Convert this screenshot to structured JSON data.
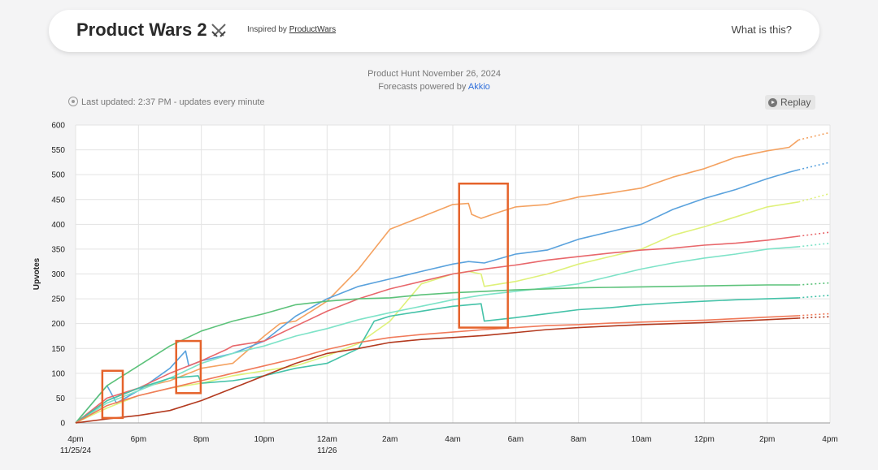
{
  "header": {
    "title": "Product Wars 2",
    "inspired_prefix": "Inspired by",
    "inspired_link": "ProductWars",
    "what_link": "What is this?"
  },
  "subtitle": {
    "line1": "Product Hunt November 26, 2024",
    "line2_prefix": "Forecasts powered by",
    "line2_link": "Akkio"
  },
  "status": {
    "last_updated": "Last updated: 2:37 PM - updates every minute",
    "replay_label": "Replay"
  },
  "chart_data": {
    "type": "line",
    "ylabel": "Upvotes",
    "xlabel": "",
    "ylim": [
      0,
      600
    ],
    "yticks": [
      0,
      50,
      100,
      150,
      200,
      250,
      300,
      350,
      400,
      450,
      500,
      550,
      600
    ],
    "xlim_hours": [
      16,
      40
    ],
    "xticks": [
      {
        "h": 16,
        "label": "4pm",
        "sub": "11/25/24"
      },
      {
        "h": 18,
        "label": "6pm"
      },
      {
        "h": 20,
        "label": "8pm"
      },
      {
        "h": 22,
        "label": "10pm"
      },
      {
        "h": 24,
        "label": "12am",
        "sub": "11/26"
      },
      {
        "h": 26,
        "label": "2am"
      },
      {
        "h": 28,
        "label": "4am"
      },
      {
        "h": 30,
        "label": "6am"
      },
      {
        "h": 32,
        "label": "8am"
      },
      {
        "h": 34,
        "label": "10am"
      },
      {
        "h": 36,
        "label": "12pm"
      },
      {
        "h": 38,
        "label": "2pm"
      },
      {
        "h": 40,
        "label": "4pm"
      }
    ],
    "grid": true,
    "forecast_style": "dotted",
    "series": [
      {
        "color": "#f4a261",
        "points": [
          [
            16,
            0
          ],
          [
            17,
            45
          ],
          [
            18,
            70
          ],
          [
            19,
            85
          ],
          [
            20,
            110
          ],
          [
            21,
            120
          ],
          [
            22,
            175
          ],
          [
            22.5,
            200
          ],
          [
            23,
            205
          ],
          [
            24,
            245
          ],
          [
            25,
            310
          ],
          [
            26,
            390
          ],
          [
            27,
            415
          ],
          [
            28,
            440
          ],
          [
            28.5,
            442
          ],
          [
            28.6,
            420
          ],
          [
            28.9,
            412
          ],
          [
            29.5,
            425
          ],
          [
            30,
            435
          ],
          [
            31,
            440
          ],
          [
            32,
            455
          ],
          [
            33,
            463
          ],
          [
            34,
            473
          ],
          [
            35,
            495
          ],
          [
            36,
            512
          ],
          [
            37,
            535
          ],
          [
            38,
            548
          ],
          [
            38.7,
            555
          ],
          [
            39,
            570
          ]
        ],
        "forecast": [
          [
            39,
            570
          ],
          [
            40,
            585
          ]
        ]
      },
      {
        "color": "#5aa2dd",
        "points": [
          [
            16,
            0
          ],
          [
            17,
            75
          ],
          [
            17.3,
            40
          ],
          [
            18,
            65
          ],
          [
            19,
            110
          ],
          [
            19.5,
            145
          ],
          [
            19.6,
            115
          ],
          [
            20,
            125
          ],
          [
            21,
            140
          ],
          [
            22,
            165
          ],
          [
            23,
            215
          ],
          [
            24,
            250
          ],
          [
            25,
            275
          ],
          [
            26,
            290
          ],
          [
            27,
            305
          ],
          [
            28,
            320
          ],
          [
            28.5,
            325
          ],
          [
            29,
            322
          ],
          [
            30,
            340
          ],
          [
            31,
            348
          ],
          [
            32,
            370
          ],
          [
            33,
            385
          ],
          [
            34,
            400
          ],
          [
            35,
            430
          ],
          [
            36,
            452
          ],
          [
            37,
            470
          ],
          [
            38,
            492
          ],
          [
            38.7,
            505
          ],
          [
            39,
            510
          ]
        ],
        "forecast": [
          [
            39,
            510
          ],
          [
            40,
            525
          ]
        ]
      },
      {
        "color": "#dff17a",
        "points": [
          [
            16,
            0
          ],
          [
            17,
            30
          ],
          [
            18,
            55
          ],
          [
            19,
            70
          ],
          [
            20,
            80
          ],
          [
            21,
            95
          ],
          [
            22,
            105
          ],
          [
            23,
            115
          ],
          [
            24,
            135
          ],
          [
            25,
            160
          ],
          [
            26,
            205
          ],
          [
            27,
            280
          ],
          [
            28,
            300
          ],
          [
            28.5,
            305
          ],
          [
            28.9,
            300
          ],
          [
            29,
            275
          ],
          [
            30,
            285
          ],
          [
            31,
            300
          ],
          [
            32,
            320
          ],
          [
            33,
            335
          ],
          [
            34,
            350
          ],
          [
            35,
            378
          ],
          [
            36,
            395
          ],
          [
            37,
            415
          ],
          [
            38,
            435
          ],
          [
            39,
            445
          ]
        ],
        "forecast": [
          [
            39,
            445
          ],
          [
            40,
            462
          ]
        ]
      },
      {
        "color": "#e8676b",
        "points": [
          [
            16,
            0
          ],
          [
            17,
            50
          ],
          [
            18,
            70
          ],
          [
            19,
            100
          ],
          [
            20,
            125
          ],
          [
            20.8,
            148
          ],
          [
            21,
            155
          ],
          [
            22,
            165
          ],
          [
            23,
            195
          ],
          [
            24,
            225
          ],
          [
            25,
            250
          ],
          [
            26,
            270
          ],
          [
            27,
            285
          ],
          [
            28,
            300
          ],
          [
            29,
            310
          ],
          [
            30,
            318
          ],
          [
            31,
            328
          ],
          [
            32,
            335
          ],
          [
            33,
            342
          ],
          [
            34,
            348
          ],
          [
            35,
            352
          ],
          [
            36,
            358
          ],
          [
            37,
            362
          ],
          [
            38,
            368
          ],
          [
            39,
            376
          ]
        ],
        "forecast": [
          [
            39,
            376
          ],
          [
            40,
            384
          ]
        ]
      },
      {
        "color": "#7ee3c8",
        "points": [
          [
            16,
            0
          ],
          [
            17,
            40
          ],
          [
            18,
            65
          ],
          [
            19,
            90
          ],
          [
            20,
            120
          ],
          [
            21,
            140
          ],
          [
            22,
            155
          ],
          [
            23,
            175
          ],
          [
            24,
            190
          ],
          [
            25,
            208
          ],
          [
            26,
            222
          ],
          [
            27,
            235
          ],
          [
            28,
            248
          ],
          [
            29,
            258
          ],
          [
            30,
            265
          ],
          [
            31,
            272
          ],
          [
            32,
            280
          ],
          [
            33,
            295
          ],
          [
            34,
            310
          ],
          [
            35,
            322
          ],
          [
            36,
            332
          ],
          [
            37,
            340
          ],
          [
            38,
            350
          ],
          [
            39,
            355
          ]
        ],
        "forecast": [
          [
            39,
            355
          ],
          [
            40,
            362
          ]
        ]
      },
      {
        "color": "#5cc27a",
        "points": [
          [
            16,
            0
          ],
          [
            17,
            75
          ],
          [
            18,
            115
          ],
          [
            19,
            155
          ],
          [
            20,
            185
          ],
          [
            21,
            205
          ],
          [
            22,
            220
          ],
          [
            23,
            238
          ],
          [
            24,
            245
          ],
          [
            25,
            250
          ],
          [
            26,
            252
          ],
          [
            27,
            258
          ],
          [
            28,
            262
          ],
          [
            29,
            265
          ],
          [
            30,
            268
          ],
          [
            31,
            270
          ],
          [
            32,
            272
          ],
          [
            33,
            273
          ],
          [
            34,
            274
          ],
          [
            35,
            275
          ],
          [
            36,
            276
          ],
          [
            37,
            277
          ],
          [
            38,
            278
          ],
          [
            39,
            278
          ]
        ],
        "forecast": [
          [
            39,
            278
          ],
          [
            40,
            282
          ]
        ]
      },
      {
        "color": "#44c2a8",
        "points": [
          [
            16,
            0
          ],
          [
            17,
            45
          ],
          [
            18,
            70
          ],
          [
            19,
            90
          ],
          [
            19.9,
            95
          ],
          [
            20,
            80
          ],
          [
            21,
            85
          ],
          [
            22,
            95
          ],
          [
            23,
            110
          ],
          [
            24,
            120
          ],
          [
            25,
            150
          ],
          [
            25.5,
            205
          ],
          [
            26,
            215
          ],
          [
            27,
            225
          ],
          [
            28,
            235
          ],
          [
            28.9,
            240
          ],
          [
            29,
            205
          ],
          [
            30,
            212
          ],
          [
            31,
            220
          ],
          [
            32,
            228
          ],
          [
            33,
            232
          ],
          [
            34,
            238
          ],
          [
            35,
            242
          ],
          [
            36,
            245
          ],
          [
            37,
            248
          ],
          [
            38,
            250
          ],
          [
            39,
            252
          ]
        ],
        "forecast": [
          [
            39,
            252
          ],
          [
            40,
            257
          ]
        ]
      },
      {
        "color": "#f07a5a",
        "points": [
          [
            16,
            0
          ],
          [
            17,
            35
          ],
          [
            18,
            55
          ],
          [
            19,
            70
          ],
          [
            20,
            85
          ],
          [
            21,
            100
          ],
          [
            22,
            115
          ],
          [
            23,
            130
          ],
          [
            24,
            148
          ],
          [
            25,
            162
          ],
          [
            26,
            172
          ],
          [
            27,
            178
          ],
          [
            28,
            183
          ],
          [
            29,
            188
          ],
          [
            30,
            192
          ],
          [
            31,
            196
          ],
          [
            32,
            198
          ],
          [
            33,
            201
          ],
          [
            34,
            203
          ],
          [
            35,
            205
          ],
          [
            36,
            207
          ],
          [
            37,
            210
          ],
          [
            38,
            213
          ],
          [
            39,
            216
          ]
        ],
        "forecast": [
          [
            39,
            216
          ],
          [
            40,
            220
          ]
        ]
      },
      {
        "color": "#b33a1f",
        "points": [
          [
            16,
            0
          ],
          [
            17,
            8
          ],
          [
            18,
            15
          ],
          [
            19,
            25
          ],
          [
            20,
            45
          ],
          [
            21,
            70
          ],
          [
            22,
            95
          ],
          [
            23,
            120
          ],
          [
            24,
            140
          ],
          [
            25,
            150
          ],
          [
            26,
            162
          ],
          [
            27,
            168
          ],
          [
            28,
            172
          ],
          [
            29,
            176
          ],
          [
            30,
            182
          ],
          [
            31,
            188
          ],
          [
            32,
            192
          ],
          [
            33,
            195
          ],
          [
            34,
            198
          ],
          [
            35,
            200
          ],
          [
            36,
            202
          ],
          [
            37,
            205
          ],
          [
            38,
            208
          ],
          [
            39,
            211
          ]
        ],
        "forecast": [
          [
            39,
            211
          ],
          [
            40,
            214
          ]
        ]
      }
    ],
    "annotations": {
      "type": "highlight-boxes",
      "color": "#e5632b",
      "boxes": [
        {
          "x": [
            16.85,
            17.5
          ],
          "y": [
            10,
            105
          ]
        },
        {
          "x": [
            19.2,
            19.98
          ],
          "y": [
            60,
            165
          ]
        },
        {
          "x": [
            28.2,
            29.75
          ],
          "y": [
            192,
            482
          ]
        }
      ]
    }
  }
}
